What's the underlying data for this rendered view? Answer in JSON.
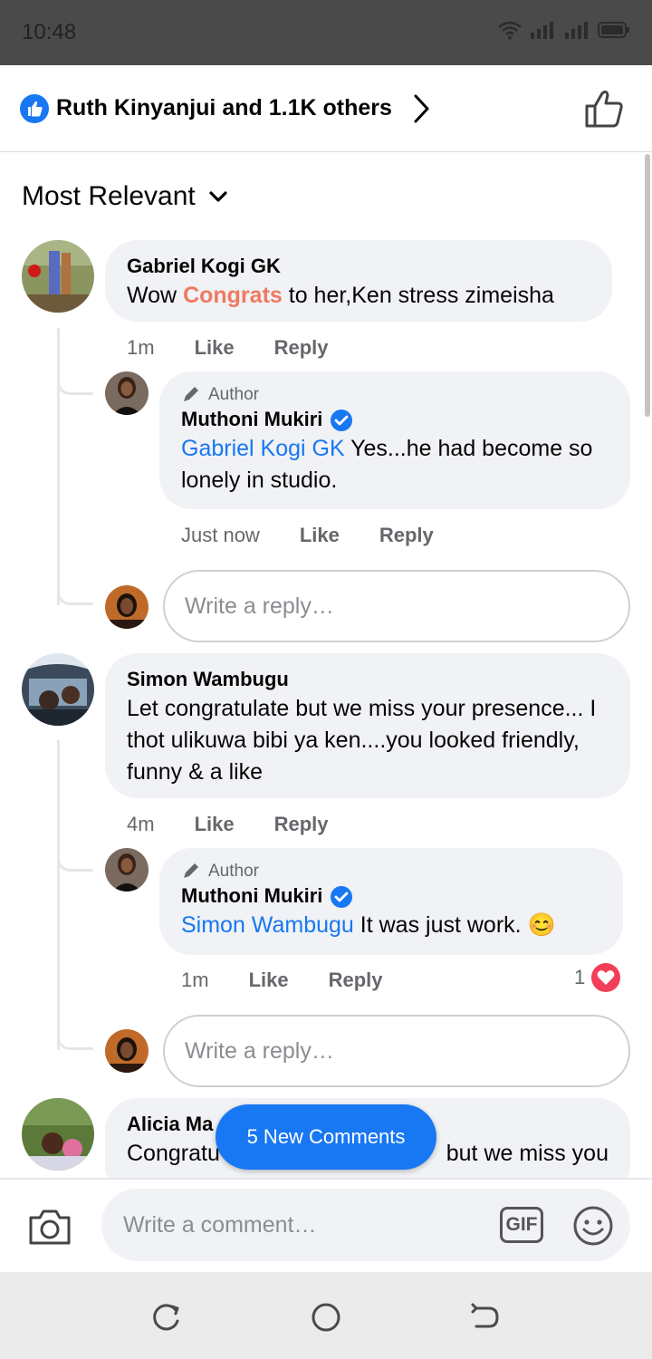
{
  "status_bar": {
    "time": "10:48"
  },
  "likes_header": {
    "text": "Ruth Kinyanjui and 1.1K others"
  },
  "sort": {
    "label": "Most Relevant"
  },
  "comments": [
    {
      "name": "Gabriel Kogi GK",
      "text_before": "Wow ",
      "highlight": "Congrats",
      "text_after": " to her,Ken stress zimeisha",
      "time": "1m",
      "like": "Like",
      "reply": "Reply",
      "replies": [
        {
          "author_badge": "Author",
          "name": "Muthoni  Mukiri",
          "mention": "Gabriel Kogi GK",
          "text": " Yes...he had become so lonely in studio.",
          "time": "Just now",
          "like": "Like",
          "reply": "Reply"
        }
      ],
      "reply_placeholder": "Write a reply…"
    },
    {
      "name": "Simon Wambugu",
      "text": "Let congratulate but we miss your presence... I thot ulikuwa bibi ya ken....you looked friendly, funny & a like",
      "time": "4m",
      "like": "Like",
      "reply": "Reply",
      "replies": [
        {
          "author_badge": "Author",
          "name": "Muthoni  Mukiri",
          "mention": "Simon Wambugu",
          "text": " It was just work. 😊",
          "time": "1m",
          "like": "Like",
          "reply": "Reply",
          "reaction_count": "1"
        }
      ],
      "reply_placeholder": "Write a reply…"
    },
    {
      "name": "Alicia Ma",
      "text_left": "Congratu",
      "text_right": "but we miss you"
    }
  ],
  "new_comments": {
    "label": "5 New Comments"
  },
  "composer": {
    "placeholder": "Write a comment…",
    "gif_label": "GIF"
  },
  "colors": {
    "brand": "#1877f2",
    "highlight": "#f0795f",
    "heart": "#f33e58"
  }
}
